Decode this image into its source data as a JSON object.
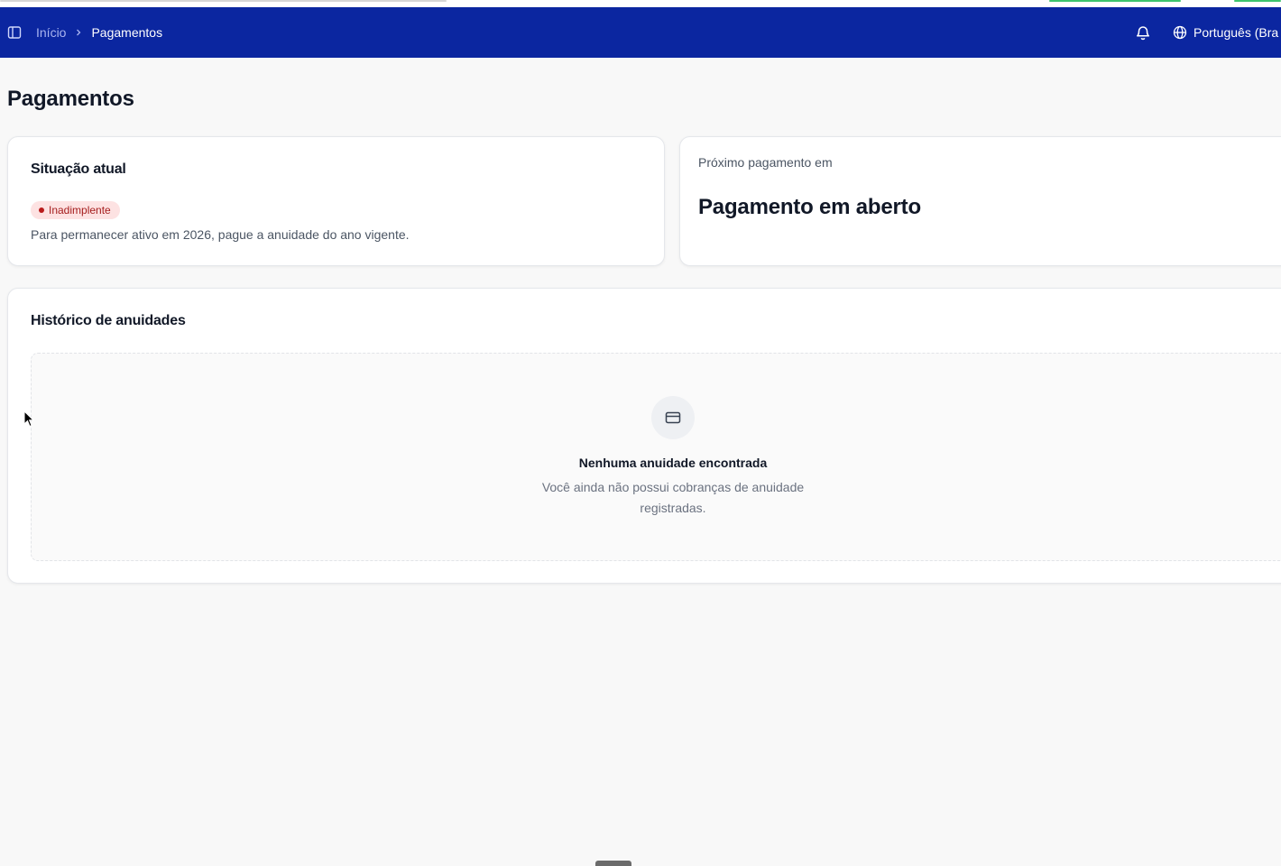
{
  "colors": {
    "topbar": "#0b26a0",
    "badge_bg": "#fde2e2",
    "badge_text": "#a51d1d",
    "page_bg": "#f8f8f8"
  },
  "icons": {
    "sidebar_toggle": "sidebar-panel-icon",
    "breadcrumb_separator": "chevron-right-icon",
    "notifications": "bell-icon",
    "language": "globe-icon",
    "empty_state": "credit-card-icon"
  },
  "header": {
    "breadcrumb": {
      "home": "Início",
      "current": "Pagamentos"
    },
    "language_label": "Português (Bra"
  },
  "page": {
    "title": "Pagamentos"
  },
  "status_card": {
    "title": "Situação atual",
    "badge": "Inadimplente",
    "description": "Para permanecer ativo em 2026, pague a anuidade do ano vigente."
  },
  "next_payment_card": {
    "label": "Próximo pagamento em",
    "value": "Pagamento em aberto"
  },
  "history_card": {
    "title": "Histórico de anuidades",
    "empty_title": "Nenhuma anuidade encontrada",
    "empty_description": "Você ainda não possui cobranças de anuidade registradas."
  }
}
